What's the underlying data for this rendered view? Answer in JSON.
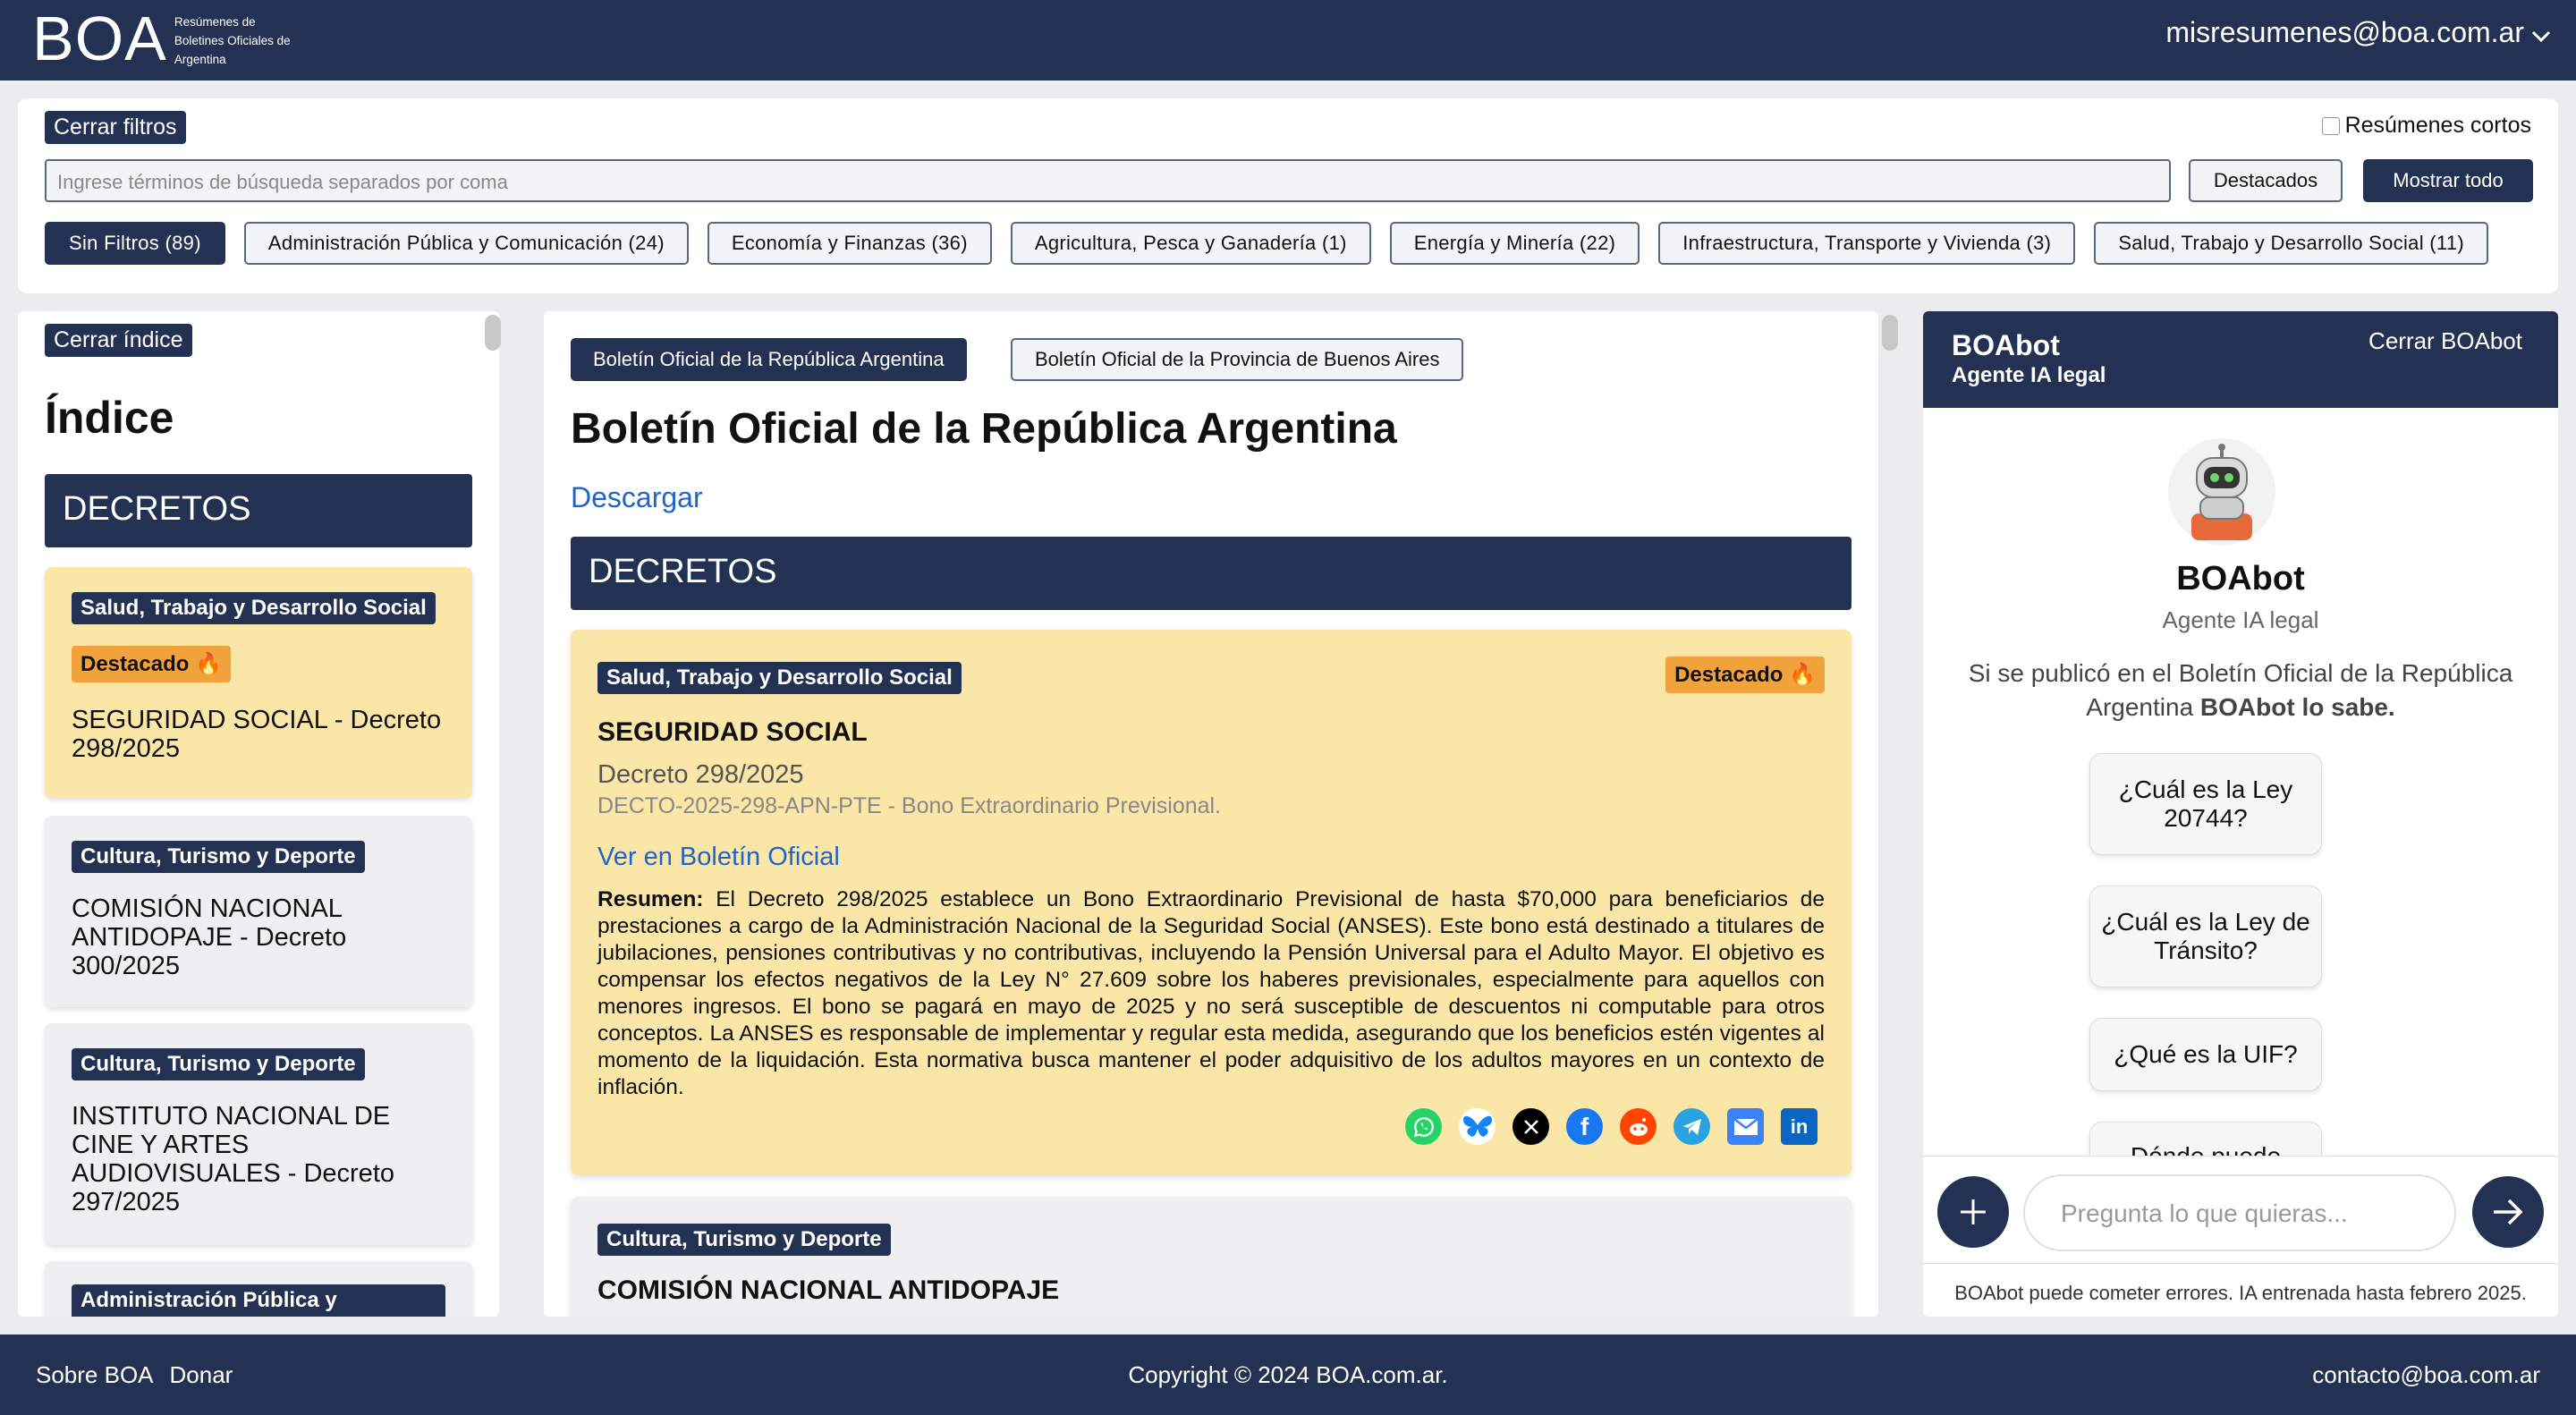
{
  "header": {
    "logo": "BOA",
    "logo_sub": "Resúmenes de Boletines Oficiales de Argentina",
    "user_email": "misresumenes@boa.com.ar"
  },
  "filters": {
    "close_label": "Cerrar filtros",
    "short_summaries_label": "Resúmenes cortos",
    "search_placeholder": "Ingrese términos de búsqueda separados por coma",
    "destacados_label": "Destacados",
    "show_all_label": "Mostrar todo",
    "chips": [
      "Sin Filtros (89)",
      "Administración Pública y Comunicación (24)",
      "Economía y Finanzas (36)",
      "Agricultura, Pesca y Ganadería (1)",
      "Energía y Minería (22)",
      "Infraestructura, Transporte y Vivienda (3)",
      "Salud, Trabajo y Desarrollo Social (11)"
    ]
  },
  "index": {
    "close_label": "Cerrar índice",
    "title": "Índice",
    "section": "DECRETOS",
    "items": [
      {
        "category": "Salud, Trabajo y Desarrollo Social",
        "badge": "Destacado 🔥",
        "title": "SEGURIDAD SOCIAL - Decreto 298/2025"
      },
      {
        "category": "Cultura, Turismo y Deporte",
        "title": "COMISIÓN NACIONAL ANTIDOPAJE - Decreto 300/2025"
      },
      {
        "category": "Cultura, Turismo y Deporte",
        "title": "INSTITUTO NACIONAL DE CINE Y ARTES AUDIOVISUALES - Decreto 297/2025"
      },
      {
        "category": "Administración Pública y"
      }
    ]
  },
  "main": {
    "tabs": [
      "Boletín Oficial de la República Argentina",
      "Boletín Oficial de la Provincia de Buenos Aires"
    ],
    "title": "Boletín Oficial de la República Argentina",
    "download_label": "Descargar",
    "section": "DECRETOS",
    "cards": [
      {
        "category": "Salud, Trabajo y Desarrollo Social",
        "badge": "Destacado 🔥",
        "title": "SEGURIDAD SOCIAL",
        "number": "Decreto 298/2025",
        "code": "DECTO-2025-298-APN-PTE - Bono Extraordinario Previsional.",
        "link": "Ver en Boletín Oficial",
        "summary_label": "Resumen:",
        "summary": "El Decreto 298/2025 establece un Bono Extraordinario Previsional de hasta $70,000 para beneficiarios de prestaciones a cargo de la Administración Nacional de la Seguridad Social (ANSES). Este bono está destinado a titulares de jubilaciones, pensiones contributivas y no contributivas, incluyendo la Pensión Universal para el Adulto Mayor. El objetivo es compensar los efectos negativos de la Ley N° 27.609 sobre los haberes previsionales, especialmente para aquellos con menores ingresos. El bono se pagará en mayo de 2025 y no será susceptible de descuentos ni computable para otros conceptos. La ANSES es responsable de implementar y regular esta medida, asegurando que los beneficios estén vigentes al momento de la liquidación. Esta normativa busca mantener el poder adquisitivo de los adultos mayores en un contexto de inflación."
      },
      {
        "category": "Cultura, Turismo y Deporte",
        "title": "COMISIÓN NACIONAL ANTIDOPAJE"
      }
    ],
    "share": [
      {
        "icon": "whatsapp-icon",
        "color": "#25d366"
      },
      {
        "icon": "bluesky-icon",
        "color": "#1185fe"
      },
      {
        "icon": "x-icon",
        "color": "#000000"
      },
      {
        "icon": "facebook-icon",
        "color": "#1877f2"
      },
      {
        "icon": "reddit-icon",
        "color": "#ff4500"
      },
      {
        "icon": "telegram-icon",
        "color": "#2aa3e0"
      },
      {
        "icon": "email-icon",
        "color": "#3b82f6"
      },
      {
        "icon": "linkedin-icon",
        "color": "#0a66c2"
      }
    ]
  },
  "bot": {
    "name": "BOAbot",
    "subtitle": "Agente IA legal",
    "close_label": "Cerrar BOAbot",
    "title": "BOAbot",
    "role": "Agente IA legal",
    "intro_prefix": "Si se publicó en el Boletín Oficial de la República Argentina ",
    "intro_bold": "BOAbot lo sabe.",
    "suggestions": [
      "¿Cuál es la Ley 20744?",
      "¿Cuál es la Ley de Tránsito?",
      "¿Qué es la UIF?",
      "Dónde puedo"
    ],
    "input_placeholder": "Pregunta lo que quieras...",
    "disclaimer": "BOAbot puede cometer errores. IA entrenada hasta febrero 2025."
  },
  "footer": {
    "links": [
      "Sobre BOA",
      "Donar"
    ],
    "copyright": "Copyright © 2024 BOA.com.ar.",
    "contact": "contacto@boa.com.ar"
  },
  "colors": {
    "navy": "#233253",
    "highlight": "#fae6a6",
    "badge": "#f2a23a",
    "link": "#1f64c8"
  }
}
